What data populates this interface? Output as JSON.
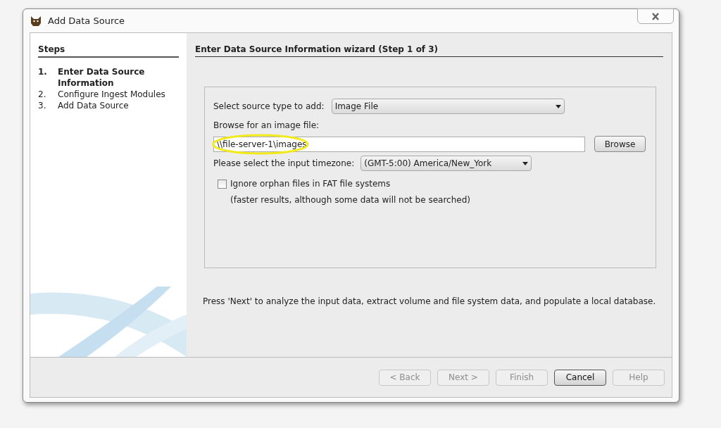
{
  "window": {
    "title": "Add Data Source"
  },
  "steps": {
    "heading": "Steps",
    "items": [
      {
        "number": "1.",
        "label": "Enter Data Source Information",
        "selected": true
      },
      {
        "number": "2.",
        "label": "Configure Ingest Modules",
        "selected": false
      },
      {
        "number": "3.",
        "label": "Add Data Source",
        "selected": false
      }
    ]
  },
  "wizard": {
    "heading": "Enter Data Source Information wizard (Step 1 of 3)",
    "source_type": {
      "label": "Select source type to add:",
      "value": "Image File"
    },
    "browse": {
      "label": "Browse for an image file:",
      "value": "\\\\file-server-1\\images",
      "button": "Browse",
      "highlighted": true
    },
    "timezone": {
      "label": "Please select the input timezone:",
      "value": "(GMT-5:00) America/New_York"
    },
    "orphan": {
      "label": "Ignore orphan files in FAT file systems",
      "checked": false,
      "note": "(faster results, although some data will not be searched)"
    },
    "hint": "Press 'Next' to analyze the input data, extract volume and file system data, and populate a local database."
  },
  "buttons": [
    {
      "label": "< Back",
      "disabled": true
    },
    {
      "label": "Next >",
      "disabled": true
    },
    {
      "label": "Finish",
      "disabled": true
    },
    {
      "label": "Cancel",
      "disabled": false
    },
    {
      "label": "Help",
      "disabled": true
    }
  ]
}
